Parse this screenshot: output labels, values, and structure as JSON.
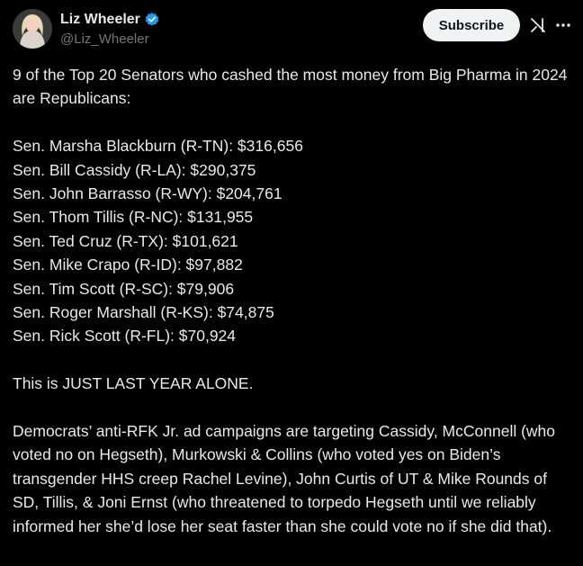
{
  "author": {
    "display_name": "Liz Wheeler",
    "handle": "@Liz_Wheeler",
    "verified_color": "#1d9bf0"
  },
  "actions": {
    "subscribe_label": "Subscribe",
    "grok_icon": "grok-icon",
    "more_icon": "more-options-icon"
  },
  "tweet": {
    "intro": "9 of the Top 20 Senators who cashed the most money from Big Pharma in 2024 are Republicans:",
    "senators": [
      "Sen. Marsha Blackburn (R-TN): $316,656",
      "Sen. Bill Cassidy (R-LA): $290,375",
      "Sen. John Barrasso (R-WY): $204,761",
      "Sen. Thom Tillis (R-NC): $131,955",
      "Sen. Ted Cruz (R-TX): $101,621",
      "Sen. Mike Crapo (R-ID): $97,882",
      "Sen. Tim Scott (R-SC): $79,906",
      "Sen. Roger Marshall (R-KS): $74,875",
      "Sen. Rick Scott (R-FL): $70,924"
    ],
    "emphasis": "This is JUST LAST YEAR ALONE.",
    "closing": "Democrats’ anti-RFK Jr. ad campaigns are targeting Cassidy, McConnell (who voted no on Hegseth), Murkowski & Collins (who voted yes on Biden’s transgender HHS creep Rachel Levine), John Curtis of UT & Mike Rounds of SD, Tillis, & Joni Ernst (who threatened to torpedo Hegseth until we reliably informed her she’d lose her seat faster than she could vote no if she did that)."
  }
}
